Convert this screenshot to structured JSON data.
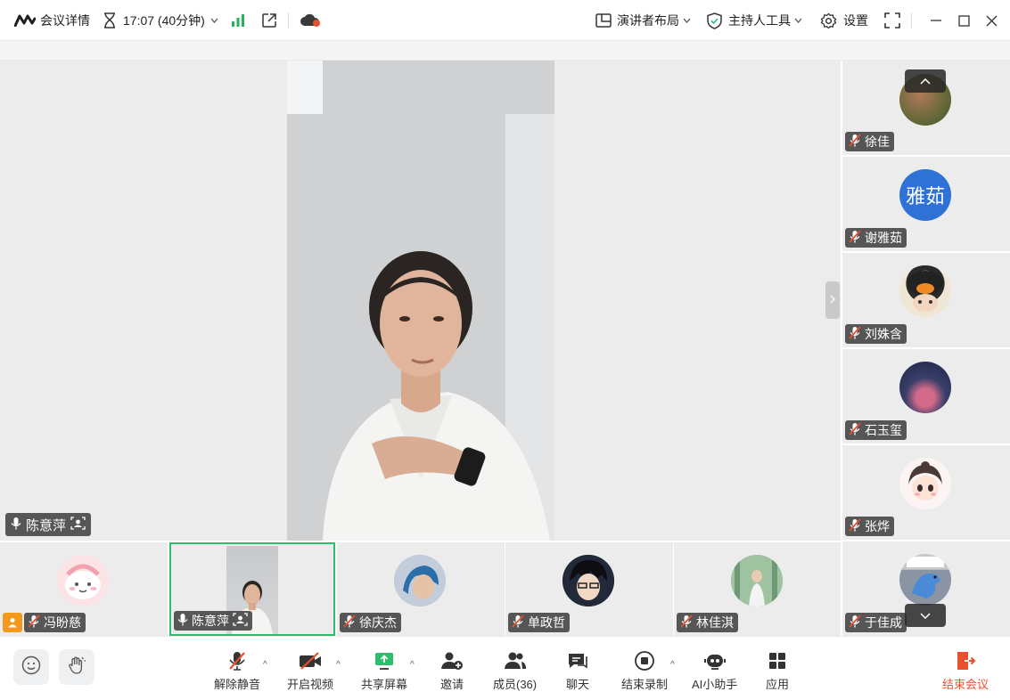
{
  "titlebar": {
    "meeting_details": "会议详情",
    "timer": "17:07 (40分钟)",
    "layout_label": "演讲者布局",
    "host_tools_label": "主持人工具",
    "settings_label": "设置"
  },
  "stage": {
    "speaker_name": "陈意萍"
  },
  "side_participants": [
    {
      "name": "徐佳"
    },
    {
      "name": "谢雅茹",
      "avatar_text": "雅茹"
    },
    {
      "name": "刘姝含"
    },
    {
      "name": "石玉玺"
    },
    {
      "name": "张烨"
    },
    {
      "name": "于佳成"
    }
  ],
  "strip_participants": [
    {
      "name": "冯盼慈"
    },
    {
      "name": "陈意萍"
    },
    {
      "name": "徐庆杰"
    },
    {
      "name": "单政哲"
    },
    {
      "name": "林佳淇"
    }
  ],
  "toolbar": {
    "unmute": "解除静音",
    "start_video": "开启视频",
    "share_screen": "共享屏幕",
    "invite": "邀请",
    "members": "成员(36)",
    "chat": "聊天",
    "end_recording": "结束录制",
    "ai_assistant": "AI小助手",
    "apps": "应用",
    "end_meeting": "结束会议"
  },
  "colors": {
    "accent_green": "#2dbd6e",
    "end_red": "#e8502f",
    "avatar_blue": "#2f72d6",
    "signal_green": "#27b35a"
  }
}
